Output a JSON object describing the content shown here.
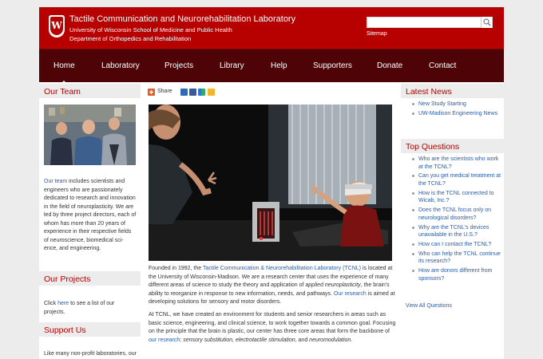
{
  "header": {
    "title": "Tactile Communication and Neurorehabilitation Laboratory",
    "subtitle1": "University of Wisconsin School of Medicine and Public Health",
    "subtitle2": "Department of Orthopedics and Rehabilitation",
    "crest_letter": "W",
    "search_placeholder": "",
    "sitemap": "Sitemap"
  },
  "nav": [
    "Home",
    "Laboratory",
    "Projects",
    "Library",
    "Help",
    "Supporters",
    "Donate",
    "Contact"
  ],
  "left": {
    "team_title": "Our Team",
    "team_link": "Our team",
    "team_text": " includes scientists and engineers who are passionately dedicated to research and innovation in the field of neuroplasticity. We are led by three project directors, each of whom has more than 20 years of experience in their respective fields of neuroscience, biomedical sci-ence, and engineering.",
    "projects_title": "Our Projects",
    "projects_pre": "Click ",
    "projects_link": "here",
    "projects_post": " to see a list of our projects.",
    "support_title": "Support Us",
    "support_text": "Like many non-profit laboratories, our ability to conduct research is"
  },
  "share": {
    "label": "Share"
  },
  "main": {
    "p1_a": "Founded in 1992, the ",
    "p1_link": "Tactile Communication & Neurorehabilitation Laboratory (TCNL)",
    "p1_b": " is located at the University of Wisconsin-Madison. We are a research center that uses the experience of many different areas of science to study the theory and application of ",
    "p1_em": "applied neuroplasticity",
    "p1_c": ", the brain's ability to reorganize in response to new information, needs, and pathways. ",
    "p1_link2": "Our research",
    "p1_d": " is aimed at developing solutions for sensory and motor disorders.",
    "p2_a": "At TCNL, we have created an environment for students and senior researchers in areas such as basic science, engineering, and clinical science, to work together towards a common goal. Focusing on the principle that the brain is plastic, our center has three core areas that form the backbone of ",
    "p2_link": "our research",
    "p2_b": ": ",
    "p2_em": "sensory substitution, electrotactile stimulation,",
    "p2_c": " and ",
    "p2_em2": "neuromodulation."
  },
  "news": {
    "title": "Latest News",
    "items": [
      "New Study Starting",
      "UW-Madison Engineering News"
    ]
  },
  "questions": {
    "title": "Top Questions",
    "items": [
      "Who are the scientists who work at the TCNL?",
      "Can you get medical treatment at the TCNL?",
      "How is the TCNL connected to Wicab, Inc.?",
      "Does the TCNL focus only on neurological disorders?",
      "Why are the TCNL's devices unavailable in the U.S.?",
      "How can I contact the TCNL?",
      "Who can help the TCNL continue its research?",
      "How are donors different from sponsors?"
    ],
    "view_all": "View All Questions"
  },
  "colors": {
    "brand_red": "#b70101",
    "nav_dark": "#4e0406",
    "link_blue": "#2a5db0"
  },
  "icons": [
    "plus-icon",
    "blogger-icon",
    "facebook-icon",
    "delicious-icon",
    "favorite-icon",
    "search-icon"
  ]
}
